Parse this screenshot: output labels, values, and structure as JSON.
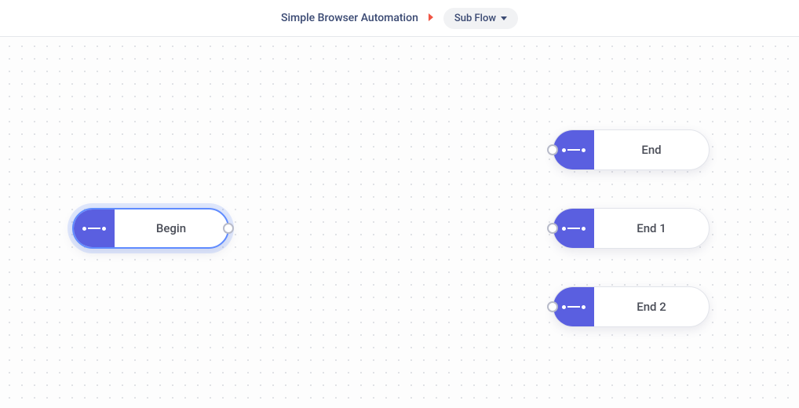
{
  "breadcrumb": {
    "parent": "Simple Browser Automation",
    "current": "Sub Flow"
  },
  "nodes": {
    "begin": {
      "label": "Begin"
    },
    "end": {
      "label": "End"
    },
    "end1": {
      "label": "End 1"
    },
    "end2": {
      "label": "End 2"
    }
  },
  "colors": {
    "node_accent": "#5a5fe0",
    "selection": "#5f8bff",
    "breadcrumb_sep": "#f05545"
  }
}
